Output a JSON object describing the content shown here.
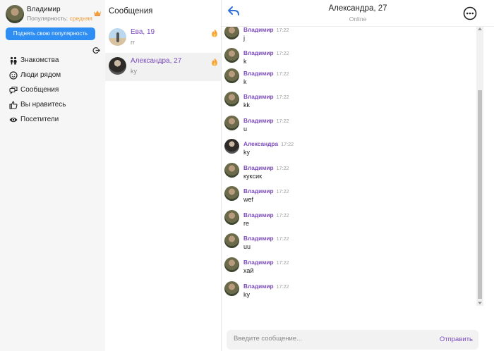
{
  "profile": {
    "name": "Владимир",
    "popularity_label": "Популярность:",
    "popularity_value": "средняя"
  },
  "boost_button": "Поднять свою популярность",
  "nav": [
    {
      "label": "Знакомства",
      "icon": "people-icon"
    },
    {
      "label": "Люди рядом",
      "icon": "smile-icon"
    },
    {
      "label": "Сообщения",
      "icon": "chat-icon"
    },
    {
      "label": "Вы нравитесь",
      "icon": "thumbs-up-icon"
    },
    {
      "label": "Посетители",
      "icon": "eye-icon"
    }
  ],
  "conversations": {
    "title": "Сообщения",
    "items": [
      {
        "name": "Ева, 19",
        "last": "rr"
      },
      {
        "name": "Александра, 27",
        "last": "ky"
      }
    ]
  },
  "chat": {
    "title": "Александра, 27",
    "status": "Online",
    "messages": [
      {
        "author": "Владимир",
        "time": "17:22",
        "text": "j"
      },
      {
        "author": "Владимир",
        "time": "17:22",
        "text": "k"
      },
      {
        "author": "Владимир",
        "time": "17:22",
        "text": "k"
      },
      {
        "author": "Владимир",
        "time": "17:22",
        "text": "kk"
      },
      {
        "author": "Владимир",
        "time": "17:22",
        "text": "u"
      },
      {
        "author": "Александра",
        "time": "17:22",
        "text": "ky"
      },
      {
        "author": "Владимир",
        "time": "17:22",
        "text": "куксик"
      },
      {
        "author": "Владимир",
        "time": "17:22",
        "text": "wef"
      },
      {
        "author": "Владимир",
        "time": "17:22",
        "text": "re"
      },
      {
        "author": "Владимир",
        "time": "17:22",
        "text": "uu"
      },
      {
        "author": "Владимир",
        "time": "17:22",
        "text": "хай"
      },
      {
        "author": "Владимир",
        "time": "17:22",
        "text": "ky"
      }
    ],
    "input_placeholder": "Введите сообщение...",
    "send_label": "Отправить"
  },
  "colors": {
    "accent_purple": "#7b4bbd",
    "primary_blue": "#2e8ef4",
    "popularity_orange": "#f29c38",
    "flame_orange": "#f7a233"
  }
}
